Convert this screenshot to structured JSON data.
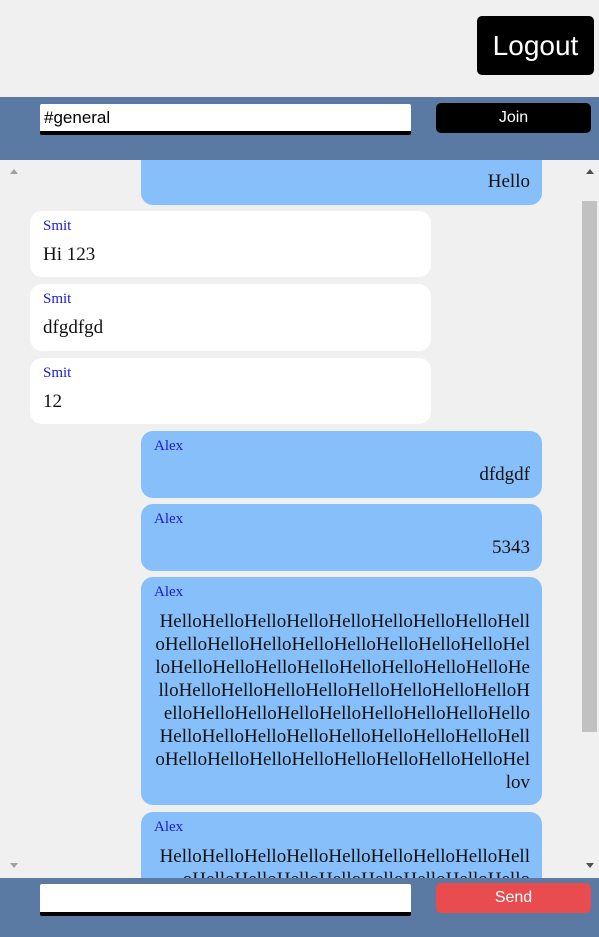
{
  "header": {
    "logout_label": "Logout"
  },
  "channel": {
    "value": "#general",
    "join_label": "Join"
  },
  "messages": [
    {
      "author": "",
      "text": "Hello",
      "mine": true
    },
    {
      "author": "Smit",
      "text": "Hi 123",
      "mine": false
    },
    {
      "author": "Smit",
      "text": "dfgdfgd",
      "mine": false
    },
    {
      "author": "Smit",
      "text": "12",
      "mine": false
    },
    {
      "author": "Alex",
      "text": "dfdgdf",
      "mine": true
    },
    {
      "author": "Alex",
      "text": "5343",
      "mine": true
    },
    {
      "author": "Alex",
      "text": "HelloHelloHelloHelloHelloHelloHelloHelloHelloHelloHelloHelloHelloHelloHelloHelloHelloHelloHelloHelloHelloHelloHelloHelloHelloHelloHelloHelloHelloHelloHelloHelloHelloHelloHelloHelloHelloHelloHelloHelloHelloHelloHelloHelloHelloHelloHelloHelloHelloHelloHelloHelloHelloHelloHelloHelloHelloHelloHelloHelloHelloHellov",
      "mine": true
    },
    {
      "author": "Alex",
      "text": "HelloHelloHelloHelloHelloHelloHelloHelloHelloHelloHelloHelloHelloHelloHelloHelloHello",
      "mine": true
    }
  ],
  "composer": {
    "value": "",
    "placeholder": "",
    "send_label": "Send"
  },
  "colors": {
    "header_bar": "#5a7aa4",
    "mine_bubble": "#87bffa",
    "other_bubble": "#ffffff",
    "author": "#1a1ad0",
    "send_button": "#e84c4f"
  }
}
